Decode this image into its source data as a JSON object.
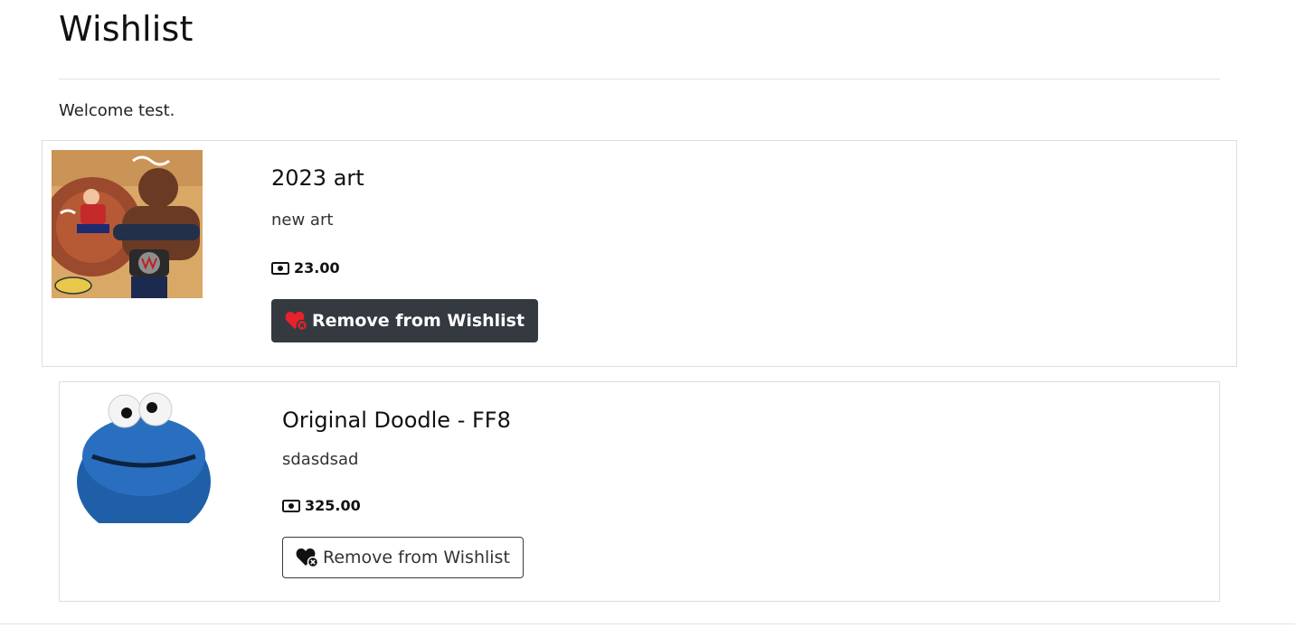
{
  "page": {
    "title": "Wishlist",
    "welcome": "Welcome test."
  },
  "items": [
    {
      "title": "2023 art",
      "description": "new art",
      "price": "23.00",
      "button_label": "Remove from Wishlist",
      "button_style": "dark"
    },
    {
      "title": "Original Doodle - FF8",
      "description": "sdasdsad",
      "price": "325.00",
      "button_label": "Remove from Wishlist",
      "button_style": "outline"
    }
  ],
  "colors": {
    "button_dark_bg": "#343a40",
    "heart_icon_active": "#e8212c",
    "heart_icon_outline": "#111111",
    "border": "#dedede"
  },
  "icons": {
    "price_icon": "money-bill-icon",
    "button_icon": "heart-remove-icon"
  }
}
